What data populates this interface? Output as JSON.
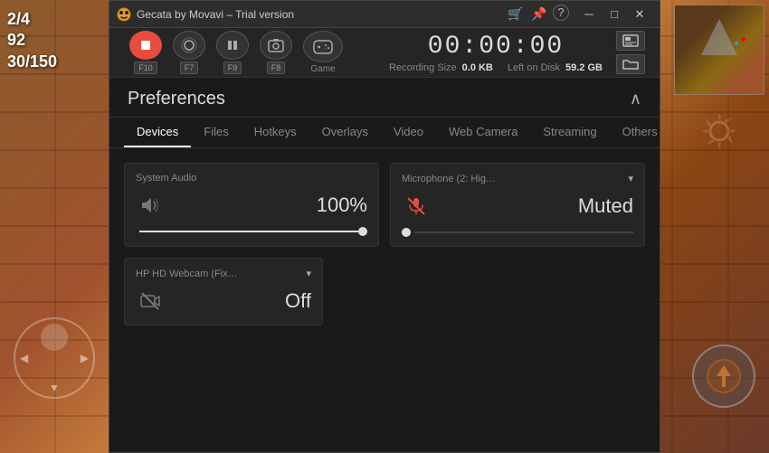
{
  "game": {
    "hud": {
      "score_top": "2/4",
      "score_mid": "92",
      "score_bot": "30/150"
    }
  },
  "titlebar": {
    "title": "Gecata by Movavi – Trial version",
    "icon": "🐱",
    "buttons": {
      "cart": "🛒",
      "pin": "📌",
      "help": "?",
      "minimize": "─",
      "maximize": "□",
      "close": "✕"
    }
  },
  "toolbar": {
    "record_label": "",
    "audio_label": "",
    "pause_label": "",
    "screenshot_label": "",
    "game_label": "Game",
    "f10": "F10",
    "f7": "F7",
    "f9": "F9",
    "f8": "F8",
    "timer": "00:00:00",
    "recording_size_label": "Recording Size",
    "recording_size_value": "0.0 KB",
    "left_on_disk_label": "Left on Disk",
    "left_on_disk_value": "59.2 GB"
  },
  "preferences": {
    "title": "Preferences",
    "tabs": [
      {
        "id": "devices",
        "label": "Devices",
        "active": true
      },
      {
        "id": "files",
        "label": "Files",
        "active": false
      },
      {
        "id": "hotkeys",
        "label": "Hotkeys",
        "active": false
      },
      {
        "id": "overlays",
        "label": "Overlays",
        "active": false
      },
      {
        "id": "video",
        "label": "Video",
        "active": false
      },
      {
        "id": "webcamera",
        "label": "Web Camera",
        "active": false
      },
      {
        "id": "streaming",
        "label": "Streaming",
        "active": false
      },
      {
        "id": "others",
        "label": "Others",
        "active": false
      }
    ],
    "devices": {
      "system_audio": {
        "title": "System Audio",
        "value": "100%",
        "icon": "speaker"
      },
      "microphone": {
        "title": "Microphone (2: Hig…",
        "dropdown_arrow": "▾",
        "value": "Muted",
        "icon": "mic-muted"
      },
      "webcam": {
        "title": "HP HD Webcam (Fix…",
        "dropdown_arrow": "▾",
        "value": "Off",
        "icon": "webcam-off"
      }
    }
  }
}
